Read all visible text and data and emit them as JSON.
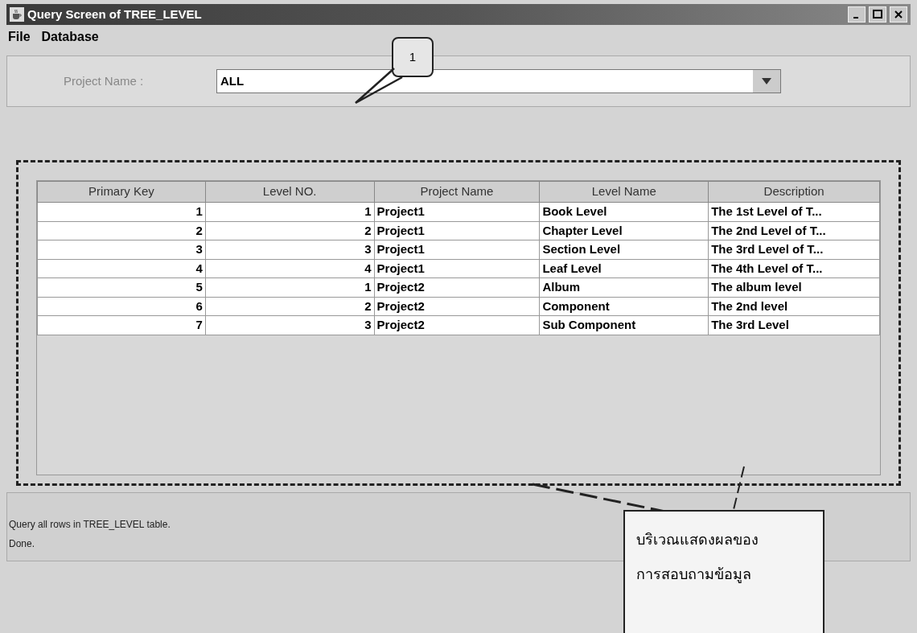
{
  "window": {
    "title": "Query Screen of TREE_LEVEL"
  },
  "menu": [
    "File",
    "Database"
  ],
  "filter": {
    "label": "Project Name :",
    "value": "ALL"
  },
  "table": {
    "columns": [
      "Primary Key",
      "Level NO.",
      "Project Name",
      "Level Name",
      "Description"
    ],
    "rows": [
      [
        "1",
        "1",
        "Project1",
        "Book Level",
        "The 1st Level of T..."
      ],
      [
        "2",
        "2",
        "Project1",
        "Chapter Level",
        "The 2nd Level of T..."
      ],
      [
        "3",
        "3",
        "Project1",
        "Section Level",
        "The 3rd Level of T..."
      ],
      [
        "4",
        "4",
        "Project1",
        "Leaf Level",
        "The 4th Level of T..."
      ],
      [
        "5",
        "1",
        "Project2",
        "Album",
        "The album level"
      ],
      [
        "6",
        "2",
        "Project2",
        "Component",
        "The 2nd level"
      ],
      [
        "7",
        "3",
        "Project2",
        "Sub Component",
        "The 3rd Level"
      ]
    ]
  },
  "status_lines": [
    "Query all rows in TREE_LEVEL table.",
    "Done."
  ],
  "annotations": {
    "number_callout": "1",
    "result_area_note": [
      "บริเวณแสดงผลของ",
      "การสอบถามข้อมูล"
    ]
  }
}
